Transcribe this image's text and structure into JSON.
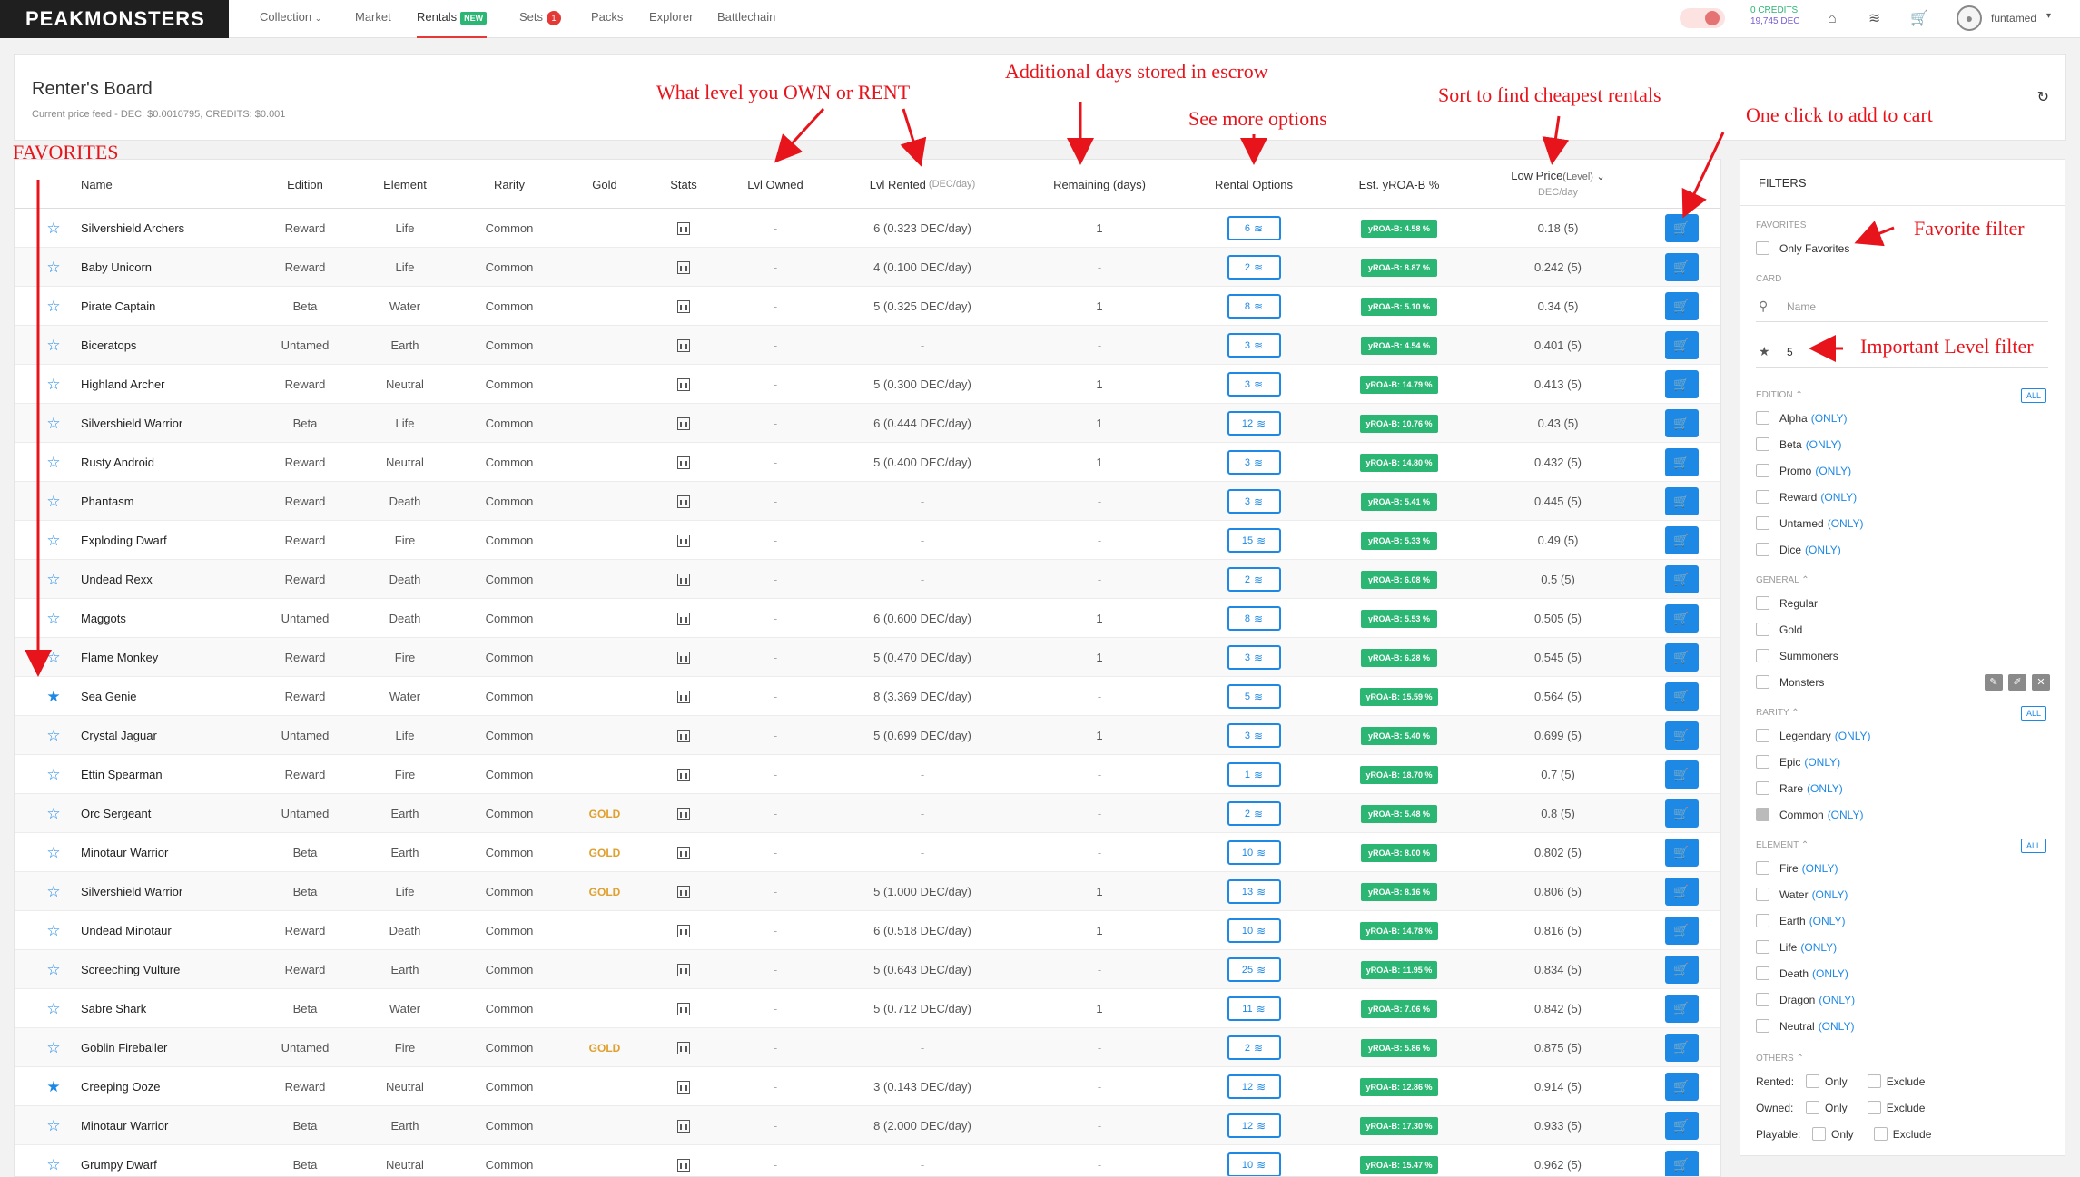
{
  "nav": {
    "logo": "PEAKMONSTERS",
    "items": [
      "Collection",
      "Market",
      "Rentals",
      "Sets",
      "Packs",
      "Explorer",
      "Battlechain"
    ],
    "new_badge": "NEW",
    "sets_count": "1",
    "credits_line": "0 CREDITS",
    "dec_line": "19,745 DEC",
    "username": "funtamed"
  },
  "board": {
    "title": "Renter's Board",
    "price_feed": "Current price feed - DEC: $0.0010795, CREDITS: $0.001"
  },
  "table": {
    "headers": {
      "name": "Name",
      "edition": "Edition",
      "element": "Element",
      "rarity": "Rarity",
      "gold": "Gold",
      "stats": "Stats",
      "lvl_owned": "Lvl Owned",
      "lvl_rented": "Lvl Rented",
      "lvl_rented_sub": "(DEC/day)",
      "remaining": "Remaining (days)",
      "rental_options": "Rental Options",
      "yroa": "Est. yROA-B %",
      "low_price": "Low Price",
      "low_price_sub": "(Level)",
      "low_price_unit": "DEC/day"
    },
    "rows": [
      {
        "fav": false,
        "name": "Silvershield Archers",
        "edition": "Reward",
        "element": "Life",
        "rarity": "Common",
        "gold": "",
        "owned": "-",
        "rented": "6 (0.323 DEC/day)",
        "remaining": "1",
        "options": "6",
        "yroa": "yROA-B: 4.58 %",
        "price": "0.18 (5)"
      },
      {
        "fav": false,
        "name": "Baby Unicorn",
        "edition": "Reward",
        "element": "Life",
        "rarity": "Common",
        "gold": "",
        "owned": "-",
        "rented": "4 (0.100 DEC/day)",
        "remaining": "-",
        "options": "2",
        "yroa": "yROA-B: 8.87 %",
        "price": "0.242 (5)"
      },
      {
        "fav": false,
        "name": "Pirate Captain",
        "edition": "Beta",
        "element": "Water",
        "rarity": "Common",
        "gold": "",
        "owned": "-",
        "rented": "5 (0.325 DEC/day)",
        "remaining": "1",
        "options": "8",
        "yroa": "yROA-B: 5.10 %",
        "price": "0.34 (5)"
      },
      {
        "fav": false,
        "name": "Biceratops",
        "edition": "Untamed",
        "element": "Earth",
        "rarity": "Common",
        "gold": "",
        "owned": "-",
        "rented": "-",
        "remaining": "-",
        "options": "3",
        "yroa": "yROA-B: 4.54 %",
        "price": "0.401 (5)"
      },
      {
        "fav": false,
        "name": "Highland Archer",
        "edition": "Reward",
        "element": "Neutral",
        "rarity": "Common",
        "gold": "",
        "owned": "-",
        "rented": "5 (0.300 DEC/day)",
        "remaining": "1",
        "options": "3",
        "yroa": "yROA-B: 14.79 %",
        "price": "0.413 (5)"
      },
      {
        "fav": false,
        "name": "Silvershield Warrior",
        "edition": "Beta",
        "element": "Life",
        "rarity": "Common",
        "gold": "",
        "owned": "-",
        "rented": "6 (0.444 DEC/day)",
        "remaining": "1",
        "options": "12",
        "yroa": "yROA-B: 10.76 %",
        "price": "0.43 (5)"
      },
      {
        "fav": false,
        "name": "Rusty Android",
        "edition": "Reward",
        "element": "Neutral",
        "rarity": "Common",
        "gold": "",
        "owned": "-",
        "rented": "5 (0.400 DEC/day)",
        "remaining": "1",
        "options": "3",
        "yroa": "yROA-B: 14.80 %",
        "price": "0.432 (5)"
      },
      {
        "fav": false,
        "name": "Phantasm",
        "edition": "Reward",
        "element": "Death",
        "rarity": "Common",
        "gold": "",
        "owned": "-",
        "rented": "-",
        "remaining": "-",
        "options": "3",
        "yroa": "yROA-B: 5.41 %",
        "price": "0.445 (5)"
      },
      {
        "fav": false,
        "name": "Exploding Dwarf",
        "edition": "Reward",
        "element": "Fire",
        "rarity": "Common",
        "gold": "",
        "owned": "-",
        "rented": "-",
        "remaining": "-",
        "options": "15",
        "yroa": "yROA-B: 5.33 %",
        "price": "0.49 (5)"
      },
      {
        "fav": false,
        "name": "Undead Rexx",
        "edition": "Reward",
        "element": "Death",
        "rarity": "Common",
        "gold": "",
        "owned": "-",
        "rented": "-",
        "remaining": "-",
        "options": "2",
        "yroa": "yROA-B: 6.08 %",
        "price": "0.5 (5)"
      },
      {
        "fav": false,
        "name": "Maggots",
        "edition": "Untamed",
        "element": "Death",
        "rarity": "Common",
        "gold": "",
        "owned": "-",
        "rented": "6 (0.600 DEC/day)",
        "remaining": "1",
        "options": "8",
        "yroa": "yROA-B: 5.53 %",
        "price": "0.505 (5)"
      },
      {
        "fav": false,
        "name": "Flame Monkey",
        "edition": "Reward",
        "element": "Fire",
        "rarity": "Common",
        "gold": "",
        "owned": "-",
        "rented": "5 (0.470 DEC/day)",
        "remaining": "1",
        "options": "3",
        "yroa": "yROA-B: 6.28 %",
        "price": "0.545 (5)"
      },
      {
        "fav": true,
        "name": "Sea Genie",
        "edition": "Reward",
        "element": "Water",
        "rarity": "Common",
        "gold": "",
        "owned": "-",
        "rented": "8 (3.369 DEC/day)",
        "remaining": "-",
        "options": "5",
        "yroa": "yROA-B: 15.59 %",
        "price": "0.564 (5)"
      },
      {
        "fav": false,
        "name": "Crystal Jaguar",
        "edition": "Untamed",
        "element": "Life",
        "rarity": "Common",
        "gold": "",
        "owned": "-",
        "rented": "5 (0.699 DEC/day)",
        "remaining": "1",
        "options": "3",
        "yroa": "yROA-B: 5.40 %",
        "price": "0.699 (5)"
      },
      {
        "fav": false,
        "name": "Ettin Spearman",
        "edition": "Reward",
        "element": "Fire",
        "rarity": "Common",
        "gold": "",
        "owned": "-",
        "rented": "-",
        "remaining": "-",
        "options": "1",
        "yroa": "yROA-B: 18.70 %",
        "price": "0.7 (5)"
      },
      {
        "fav": false,
        "name": "Orc Sergeant",
        "edition": "Untamed",
        "element": "Earth",
        "rarity": "Common",
        "gold": "GOLD",
        "owned": "-",
        "rented": "-",
        "remaining": "-",
        "options": "2",
        "yroa": "yROA-B: 5.48 %",
        "price": "0.8 (5)"
      },
      {
        "fav": false,
        "name": "Minotaur Warrior",
        "edition": "Beta",
        "element": "Earth",
        "rarity": "Common",
        "gold": "GOLD",
        "owned": "-",
        "rented": "-",
        "remaining": "-",
        "options": "10",
        "yroa": "yROA-B: 8.00 %",
        "price": "0.802 (5)"
      },
      {
        "fav": false,
        "name": "Silvershield Warrior",
        "edition": "Beta",
        "element": "Life",
        "rarity": "Common",
        "gold": "GOLD",
        "owned": "-",
        "rented": "5 (1.000 DEC/day)",
        "remaining": "1",
        "options": "13",
        "yroa": "yROA-B: 8.16 %",
        "price": "0.806 (5)"
      },
      {
        "fav": false,
        "name": "Undead Minotaur",
        "edition": "Reward",
        "element": "Death",
        "rarity": "Common",
        "gold": "",
        "owned": "-",
        "rented": "6 (0.518 DEC/day)",
        "remaining": "1",
        "options": "10",
        "yroa": "yROA-B: 14.78 %",
        "price": "0.816 (5)"
      },
      {
        "fav": false,
        "name": "Screeching Vulture",
        "edition": "Reward",
        "element": "Earth",
        "rarity": "Common",
        "gold": "",
        "owned": "-",
        "rented": "5 (0.643 DEC/day)",
        "remaining": "-",
        "options": "25",
        "yroa": "yROA-B: 11.95 %",
        "price": "0.834 (5)"
      },
      {
        "fav": false,
        "name": "Sabre Shark",
        "edition": "Beta",
        "element": "Water",
        "rarity": "Common",
        "gold": "",
        "owned": "-",
        "rented": "5 (0.712 DEC/day)",
        "remaining": "1",
        "options": "11",
        "yroa": "yROA-B: 7.06 %",
        "price": "0.842 (5)"
      },
      {
        "fav": false,
        "name": "Goblin Fireballer",
        "edition": "Untamed",
        "element": "Fire",
        "rarity": "Common",
        "gold": "GOLD",
        "owned": "-",
        "rented": "-",
        "remaining": "-",
        "options": "2",
        "yroa": "yROA-B: 5.86 %",
        "price": "0.875 (5)"
      },
      {
        "fav": true,
        "name": "Creeping Ooze",
        "edition": "Reward",
        "element": "Neutral",
        "rarity": "Common",
        "gold": "",
        "owned": "-",
        "rented": "3 (0.143 DEC/day)",
        "remaining": "-",
        "options": "12",
        "yroa": "yROA-B: 12.86 %",
        "price": "0.914 (5)"
      },
      {
        "fav": false,
        "name": "Minotaur Warrior",
        "edition": "Beta",
        "element": "Earth",
        "rarity": "Common",
        "gold": "",
        "owned": "-",
        "rented": "8 (2.000 DEC/day)",
        "remaining": "-",
        "options": "12",
        "yroa": "yROA-B: 17.30 %",
        "price": "0.933 (5)"
      },
      {
        "fav": false,
        "name": "Grumpy Dwarf",
        "edition": "Beta",
        "element": "Neutral",
        "rarity": "Common",
        "gold": "",
        "owned": "-",
        "rented": "-",
        "remaining": "-",
        "options": "10",
        "yroa": "yROA-B: 15.47 %",
        "price": "0.962 (5)"
      }
    ]
  },
  "filters": {
    "title": "FILTERS",
    "favorites_label": "FAVORITES",
    "only_favorites": "Only Favorites",
    "card_label": "CARD",
    "name_placeholder": "Name",
    "level_value": "5",
    "all_label": "ALL",
    "only_label": "(ONLY)",
    "edition_label": "EDITION",
    "editions": [
      "Alpha",
      "Beta",
      "Promo",
      "Reward",
      "Untamed",
      "Dice"
    ],
    "general_label": "GENERAL",
    "general": [
      "Regular",
      "Gold",
      "Summoners",
      "Monsters"
    ],
    "rarity_label": "RARITY",
    "rarities": [
      "Legendary",
      "Epic",
      "Rare",
      "Common"
    ],
    "element_label": "ELEMENT",
    "elements": [
      "Fire",
      "Water",
      "Earth",
      "Life",
      "Death",
      "Dragon",
      "Neutral"
    ],
    "others_label": "OTHERS",
    "others": [
      "Rented:",
      "Owned:",
      "Playable:"
    ],
    "only_opt": "Only",
    "exclude_opt": "Exclude"
  },
  "annotations": {
    "favorites": "FAVORITES",
    "level": "What level you OWN or RENT",
    "escrow": "Additional days stored in escrow",
    "options": "See more options",
    "sort": "Sort to find cheapest rentals",
    "cart": "One click to add to cart",
    "fav_filter": "Favorite filter",
    "level_filter": "Important Level filter"
  },
  "colors": {
    "accent": "#1e88e5",
    "yroa_green": "#2bb673",
    "gold": "#e0a030",
    "annotation_red": "#e8141c"
  }
}
